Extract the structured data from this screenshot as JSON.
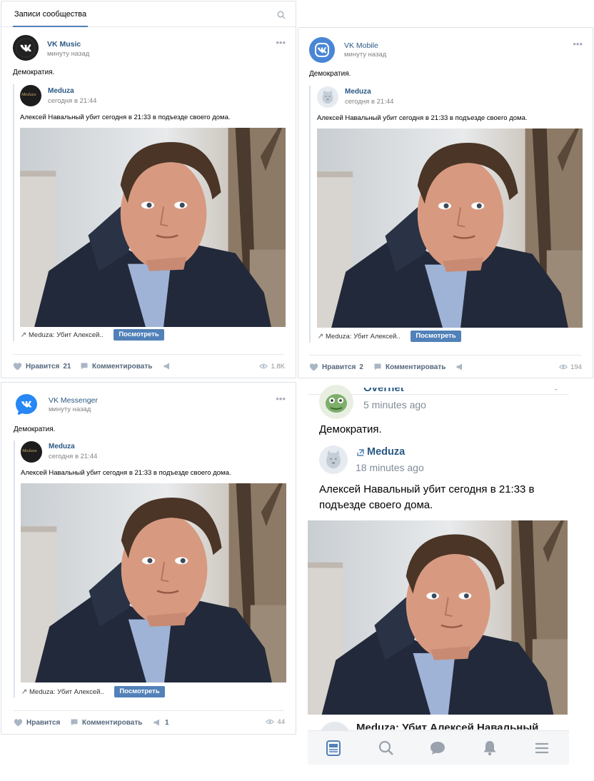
{
  "header_tab": "Записи сообщества",
  "posts": [
    {
      "author": "VK Music",
      "time": "минуту назад",
      "text": "Демократия.",
      "repost": {
        "author": "Meduza",
        "avatar_text": "Meduza",
        "time": "сегодня в 21:44",
        "text": "Алексей Навальный убит сегодня в 21:33 в подъезде своего дома."
      },
      "link_title": "Meduza: Убит Алексей..",
      "link_button": "Посмотреть",
      "like_label": "Нравится",
      "like_count": "21",
      "comment_label": "Комментировать",
      "share_count": "",
      "views": "1.8K"
    },
    {
      "author": "VK Mobile",
      "time": "минуту назад",
      "text": "Демократия.",
      "repost": {
        "author": "Meduza",
        "time": "сегодня в 21:44",
        "text": "Алексей Навальный убит сегодня в 21:33 в подъезде своего дома."
      },
      "link_title": "Meduza: Убит Алексей..",
      "link_button": "Посмотреть",
      "like_label": "Нравится",
      "like_count": "2",
      "comment_label": "Комментировать",
      "share_count": "",
      "views": "194"
    },
    {
      "author": "VK Messenger",
      "time": "минуту назад",
      "text": "Демократия.",
      "repost": {
        "author": "Meduza",
        "avatar_text": "Meduza",
        "time": "сегодня в 21:44",
        "text": "Алексей Навальный убит сегодня в 21:33 в подъезде своего дома."
      },
      "link_title": "Meduza: Убит Алексей..",
      "link_button": "Посмотреть",
      "like_label": "Нравится",
      "like_count": "",
      "comment_label": "Комментировать",
      "share_count": "1",
      "views": "44"
    }
  ],
  "mobile": {
    "author_partial": "Overnet",
    "time": "5 minutes ago",
    "text": "Демократия.",
    "repost_author": "Meduza",
    "repost_time": "18 minutes ago",
    "repost_text": "Алексей Навальный убит сегодня в 21:33 в подъезде своего дома.",
    "link_partial": "Meduza: Убит Алексей Навальный"
  },
  "colors": {
    "vk_blue": "#5181b8",
    "link": "#2a5885",
    "icon_active": "#5181b8",
    "icon_inactive": "#99a2ad"
  }
}
